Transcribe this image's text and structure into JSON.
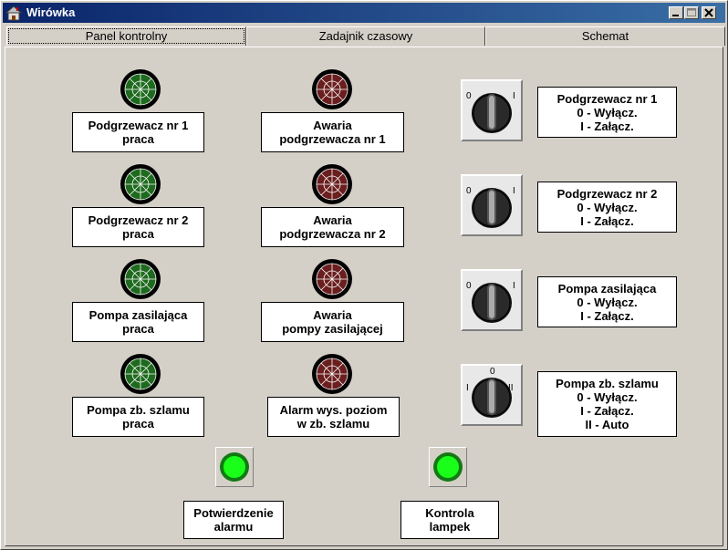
{
  "window": {
    "title": "Wirówka"
  },
  "tabs": [
    {
      "label": "Panel kontrolny",
      "active": true
    },
    {
      "label": "Zadajnik czasowy",
      "active": false
    },
    {
      "label": "Schemat",
      "active": false
    }
  ],
  "status_lamps": [
    {
      "label": "Podgrzewacz nr 1\npraca",
      "color": "#1e6a1e"
    },
    {
      "label": "Podgrzewacz nr 2\npraca",
      "color": "#1e6a1e"
    },
    {
      "label": "Pompa zasilająca\npraca",
      "color": "#1e6a1e"
    },
    {
      "label": "Pompa zb. szlamu\npraca",
      "color": "#1e6a1e"
    }
  ],
  "alarm_lamps": [
    {
      "label": "Awaria\npodgrzewacza nr 1",
      "color": "#6a1e1e"
    },
    {
      "label": "Awaria\npodgrzewacza nr 2",
      "color": "#6a1e1e"
    },
    {
      "label": "Awaria\npompy zasilającej",
      "color": "#6a1e1e"
    },
    {
      "label": "Alarm wys. poziom\nw zb. szlamu",
      "color": "#6a1e1e"
    }
  ],
  "switches": [
    {
      "marks": [
        "0",
        "I"
      ],
      "label": "Podgrzewacz nr 1\n0 - Wyłącz.\nI - Załącz."
    },
    {
      "marks": [
        "0",
        "I"
      ],
      "label": "Podgrzewacz nr 2\n0 - Wyłącz.\nI - Załącz."
    },
    {
      "marks": [
        "0",
        "I"
      ],
      "label": "Pompa zasilająca\n0 - Wyłącz.\nI - Załącz."
    },
    {
      "marks": [
        "I",
        "0",
        "II"
      ],
      "label": "Pompa zb. szlamu\n0 - Wyłącz.\nI - Załącz.\nII - Auto"
    }
  ],
  "buttons": [
    {
      "label": "Potwierdzenie\nalarmu",
      "color": "#1aff1a"
    },
    {
      "label": "Kontrola\nlampek",
      "color": "#1aff1a"
    }
  ],
  "colors": {
    "title_start": "#0a246a",
    "title_end": "#3a6ea5",
    "face": "#d4d0c8"
  },
  "icons": {
    "app": "house-icon",
    "minimize": "minimize-icon",
    "maximize": "maximize-icon",
    "close": "close-icon"
  }
}
